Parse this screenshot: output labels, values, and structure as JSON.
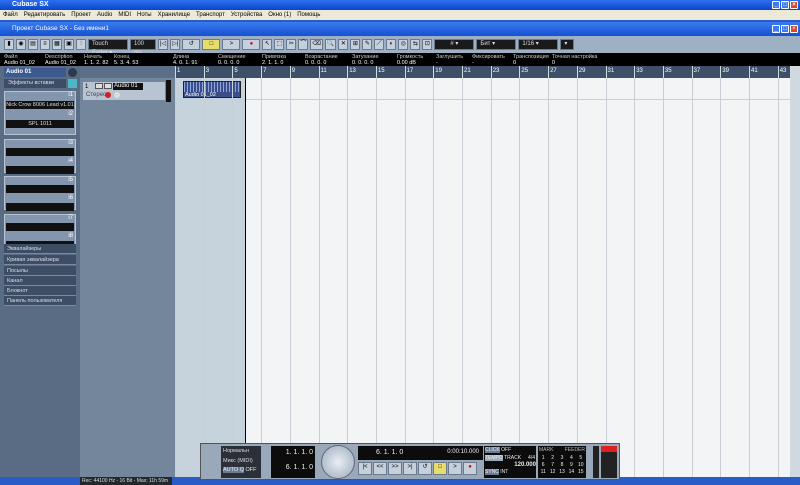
{
  "app": {
    "title": "Cubase SX",
    "project_title": "Проект Cubase SX - Без имени1"
  },
  "menu": [
    "Файл",
    "Редактировать",
    "Проект",
    "Audio",
    "MIDI",
    "Ноты",
    "Хранилище",
    "Транспорт",
    "Устройства",
    "Окно (1)",
    "Помощь"
  ],
  "toolbar": {
    "automation_mode": "Touch Fader",
    "preroll": "100 ms",
    "grid": "Бит",
    "quantize": "1/16"
  },
  "info_line": [
    {
      "label": "Файл",
      "value": "Audio 01_02"
    },
    {
      "label": "Description",
      "value": "Audio 01_02"
    },
    {
      "label": "Начать",
      "value": "1. 1. 2. 82"
    },
    {
      "label": "Конец",
      "value": "5. 3. 4. 53"
    },
    {
      "label": "Длина",
      "value": "4. 0. 1. 91"
    },
    {
      "label": "Смещение",
      "value": "0. 0. 0. 0"
    },
    {
      "label": "Привязка",
      "value": "2. 1. 1. 0"
    },
    {
      "label": "Возрастание",
      "value": "0. 0. 0. 0"
    },
    {
      "label": "Затухание",
      "value": "0. 0. 0. 0"
    },
    {
      "label": "Громкость",
      "value": "0.00 dB"
    },
    {
      "label": "Заглушить",
      "value": "-"
    },
    {
      "label": "Фиксировать",
      "value": "-"
    },
    {
      "label": "Транспозиция",
      "value": "0"
    },
    {
      "label": "Точная настройка",
      "value": "0"
    }
  ],
  "inspector": {
    "track_name": "Audio 01",
    "insert_label": "Эффекты вставки",
    "insert1": "Nick Crow 8006 Lead v1.01",
    "insert2": "SPL 1011",
    "slot_numbers": [
      "i1",
      "i2",
      "i3",
      "i4",
      "i5",
      "i6",
      "i7",
      "i8"
    ],
    "sections": [
      "Эквалайзеры",
      "Кривая эквалайзера",
      "Посылы",
      "Канал",
      "Блокнот",
      "Панель пользователя"
    ]
  },
  "track": {
    "number": "1",
    "name": "Audio 01",
    "channel": "Стерео"
  },
  "event": {
    "name": "Audio 01_02"
  },
  "ruler": [
    "1",
    "3",
    "5",
    "7",
    "9",
    "11",
    "13",
    "15",
    "17",
    "19",
    "21",
    "23",
    "25",
    "27",
    "29",
    "31",
    "33",
    "35",
    "37",
    "39",
    "41",
    "43"
  ],
  "transport": {
    "mode1": "Нормальн",
    "mode2": "Микс (MIDI)",
    "auto_q": "AUTO Q",
    "auto_q_state": "OFF",
    "left_locator": "1. 1. 1. 0",
    "right_locator": "6. 1. 1. 0",
    "position": "6. 1. 1. 0",
    "time": "0:00:10.000",
    "click": "CLICK",
    "click_state": "OFF",
    "tempo": "TEMPO",
    "tempo_mode": "TRACK",
    "signature": "4/4",
    "tempo_value": "120.000",
    "sync": "SYNC",
    "sync_state": "INT",
    "marker": "MARK",
    "marker_sub": "FEEDER",
    "markers": [
      "1",
      "2",
      "3",
      "4",
      "5",
      "6",
      "7",
      "8",
      "9",
      "10",
      "11",
      "12",
      "13",
      "14",
      "15"
    ]
  },
  "status": "Rec: 44100 Hz - 16 Bit - Max: 11h 59m"
}
